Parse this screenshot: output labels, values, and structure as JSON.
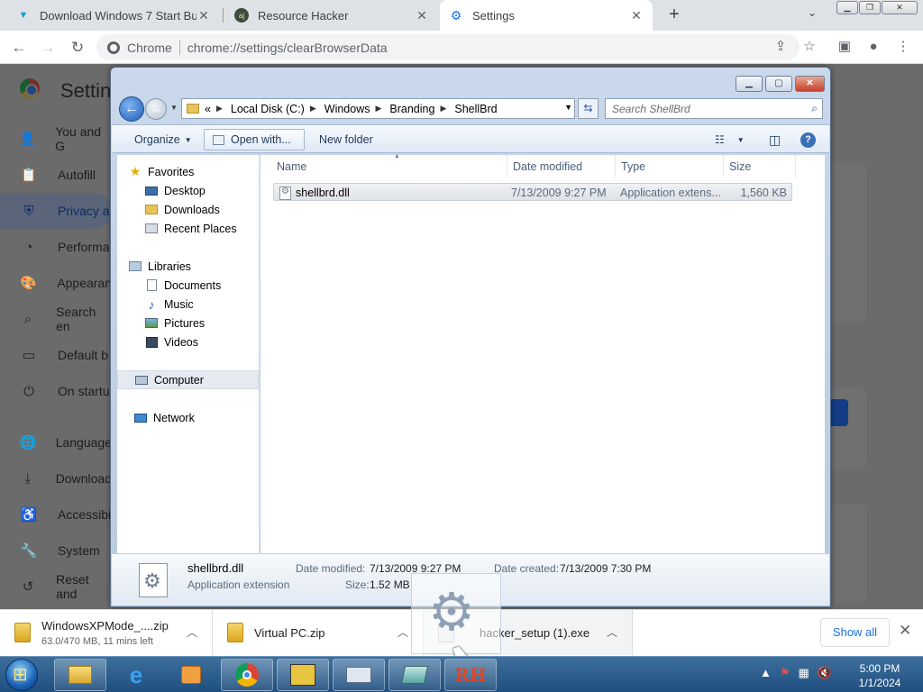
{
  "browser": {
    "tabs": [
      {
        "title": "Download Windows 7 Start Button",
        "icon": "vee-favicon-icon"
      },
      {
        "title": "Resource Hacker",
        "icon": "aj-favicon-icon"
      },
      {
        "title": "Settings",
        "icon": "gear-icon"
      }
    ],
    "site_chip": "Chrome",
    "url": "chrome://settings/clearBrowserData"
  },
  "settings": {
    "title": "Settings",
    "nav": [
      "You and G",
      "Autofill",
      "Privacy a",
      "Performa",
      "Appearan",
      "Search en",
      "Default b",
      "On startu",
      "Language",
      "Download",
      "Accessibi",
      "System",
      "Reset and"
    ]
  },
  "explorer": {
    "breadcrumb": [
      "Local Disk (C:)",
      "Windows",
      "Branding",
      "ShellBrd"
    ],
    "breadcrumb_prefix": "«",
    "search_placeholder": "Search ShellBrd",
    "commands": {
      "organize": "Organize",
      "open_with": "Open with...",
      "new_folder": "New folder"
    },
    "nav": {
      "favorites": "Favorites",
      "desktop": "Desktop",
      "downloads": "Downloads",
      "recent": "Recent Places",
      "libraries": "Libraries",
      "documents": "Documents",
      "music": "Music",
      "pictures": "Pictures",
      "videos": "Videos",
      "computer": "Computer",
      "network": "Network"
    },
    "columns": [
      "Name",
      "Date modified",
      "Type",
      "Size"
    ],
    "files": [
      {
        "name": "shellbrd.dll",
        "modified": "7/13/2009 9:27 PM",
        "type": "Application extens...",
        "size": "1,560 KB"
      }
    ],
    "details": {
      "name": "shellbrd.dll",
      "kind": "Application extension",
      "modified_label": "Date modified:",
      "modified": "7/13/2009 9:27 PM",
      "size_label": "Size:",
      "size": "1.52 MB",
      "created_label": "Date created:",
      "created": "7/13/2009 7:30 PM"
    }
  },
  "downloads": {
    "items": [
      {
        "name": "WindowsXPMode_....zip",
        "status": "63.0/470 MB, 11 mins left"
      },
      {
        "name": "Virtual PC.zip"
      },
      {
        "name": "hacker_setup (1).exe"
      }
    ],
    "show_all": "Show all"
  },
  "taskbar": {
    "time": "5:00 PM",
    "date": "1/1/2024"
  },
  "colors": {
    "accent": "#1a73e8",
    "explorer_frame": "#c9d8ea",
    "taskbar": "#1f4f7f"
  }
}
